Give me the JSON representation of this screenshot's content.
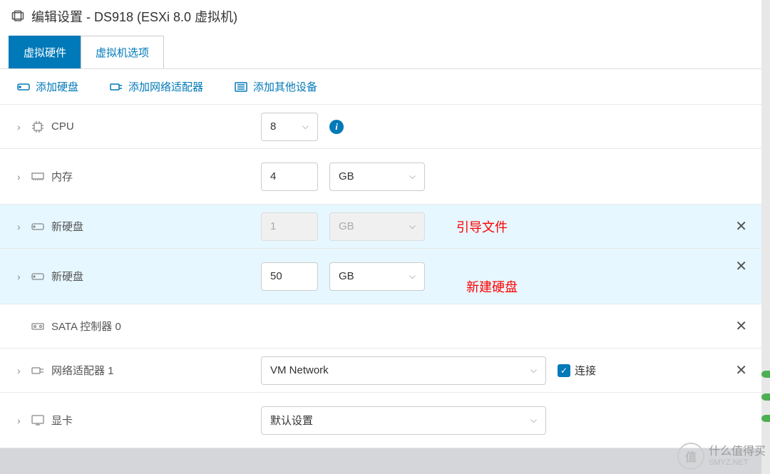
{
  "header": {
    "title": "编辑设置 - DS918 (ESXi 8.0 虚拟机)"
  },
  "tabs": {
    "hardware": "虚拟硬件",
    "options": "虚拟机选项"
  },
  "toolbar": {
    "add_disk": "添加硬盘",
    "add_nic": "添加网络适配器",
    "add_other": "添加其他设备"
  },
  "rows": {
    "cpu": {
      "label": "CPU",
      "value": "8"
    },
    "memory": {
      "label": "内存",
      "value": "4",
      "unit": "GB"
    },
    "disk1": {
      "label": "新硬盘",
      "value": "1",
      "unit": "GB",
      "note": "引导文件"
    },
    "disk2": {
      "label": "新硬盘",
      "value": "50",
      "unit": "GB",
      "note": "新建硬盘"
    },
    "sata": {
      "label": "SATA 控制器 0"
    },
    "nic": {
      "label": "网络适配器 1",
      "value": "VM Network",
      "connect": "连接"
    },
    "gpu": {
      "label": "显卡",
      "value": "默认设置"
    }
  },
  "watermark": {
    "text": "什么值得买",
    "badge": "值",
    "site": "SMYZ.NET"
  }
}
